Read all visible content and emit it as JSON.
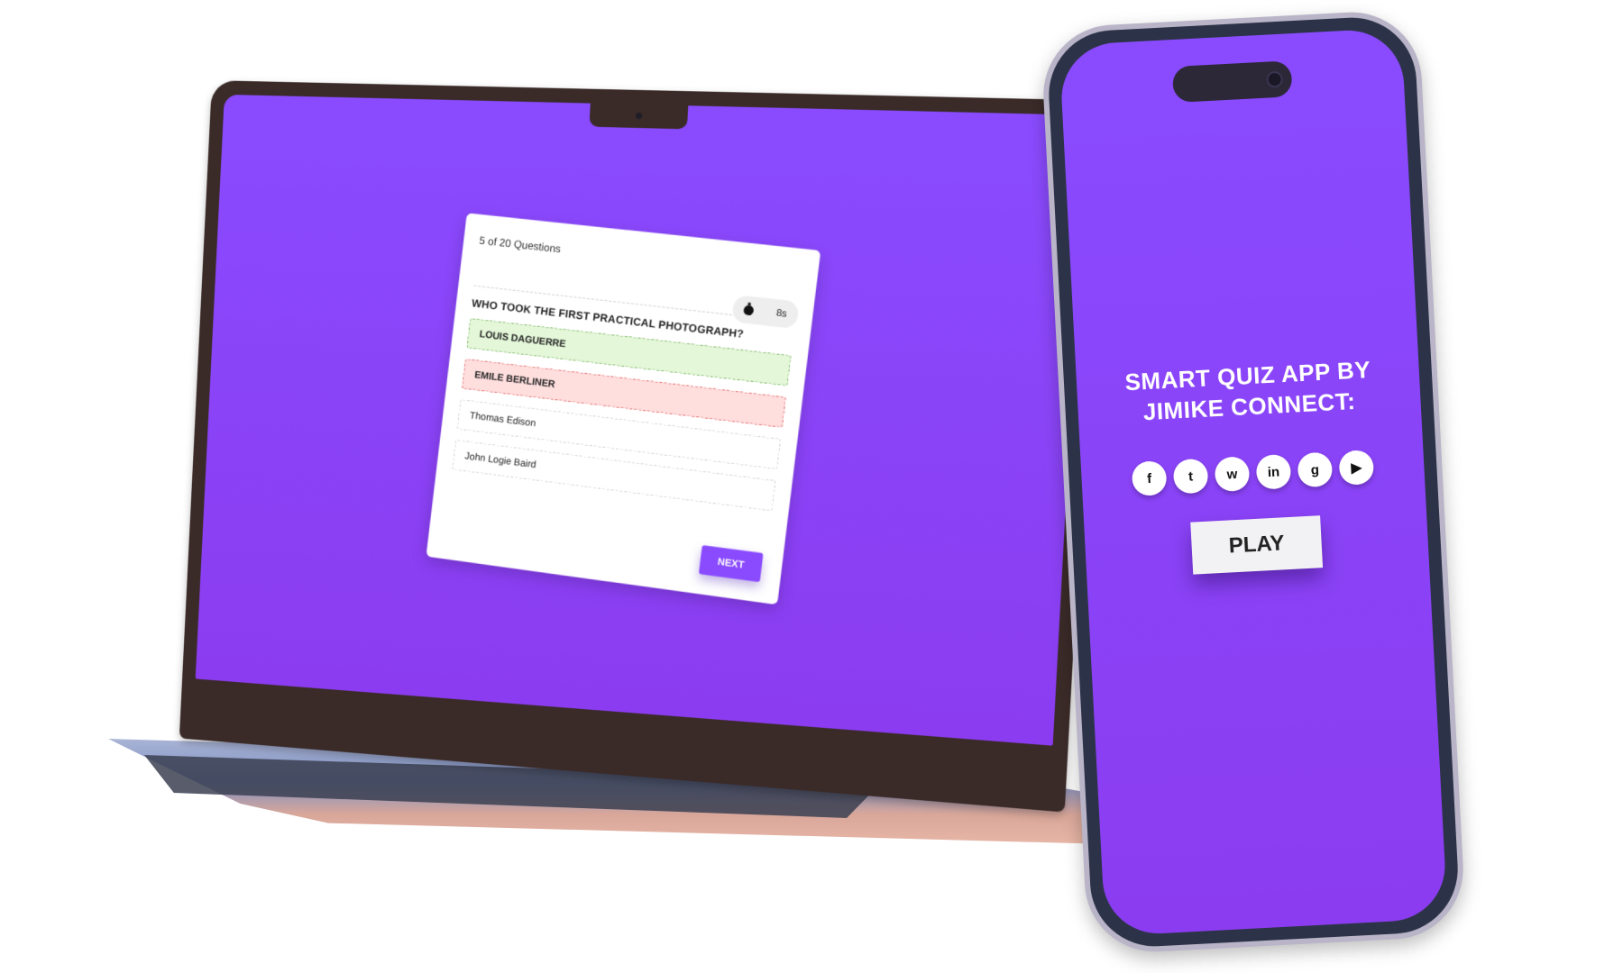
{
  "colors": {
    "accent": "#8a4bff",
    "correct_bg": "#e4f7d8",
    "wrong_bg": "#ffdede"
  },
  "quiz": {
    "progress_text": "5 of 20 Questions",
    "timer": {
      "icon": "stopwatch-icon",
      "value": "8s"
    },
    "question": "WHO TOOK THE FIRST PRACTICAL PHOTOGRAPH?",
    "options": [
      {
        "label": "LOUIS DAGUERRE",
        "state": "correct"
      },
      {
        "label": "EMILE BERLINER",
        "state": "wrong"
      },
      {
        "label": "Thomas Edison",
        "state": "neutral"
      },
      {
        "label": "John Logie Baird",
        "state": "neutral"
      }
    ],
    "next_label": "NEXT"
  },
  "phone": {
    "title": "SMART QUIZ APP BY JIMIKE CONNECT:",
    "socials": [
      {
        "icon": "facebook-icon",
        "glyph": "f"
      },
      {
        "icon": "twitter-icon",
        "glyph": "t"
      },
      {
        "icon": "whatsapp-icon",
        "glyph": "w"
      },
      {
        "icon": "linkedin-icon",
        "glyph": "in"
      },
      {
        "icon": "github-icon",
        "glyph": "g"
      },
      {
        "icon": "youtube-icon",
        "glyph": "▶"
      }
    ],
    "play_label": "PLAY"
  }
}
